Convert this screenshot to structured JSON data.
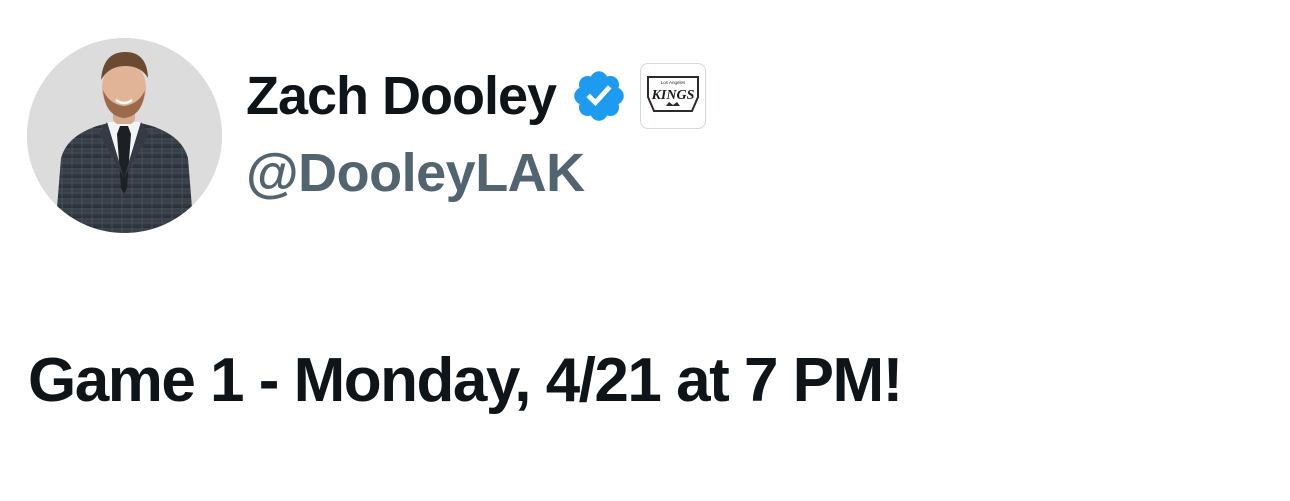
{
  "author": {
    "display_name": "Zach Dooley",
    "handle": "@DooleyLAK",
    "verified": true,
    "affiliate_badge_text": "KINGS",
    "affiliate_badge_subtext": "Los Angeles",
    "avatar_icon": "profile-photo"
  },
  "tweet": {
    "text": "Game 1 - Monday, 4/21 at 7 PM!"
  },
  "colors": {
    "text_primary": "#0f1419",
    "text_secondary": "#536471",
    "verified_blue": "#1d9bf0",
    "background": "#ffffff"
  }
}
